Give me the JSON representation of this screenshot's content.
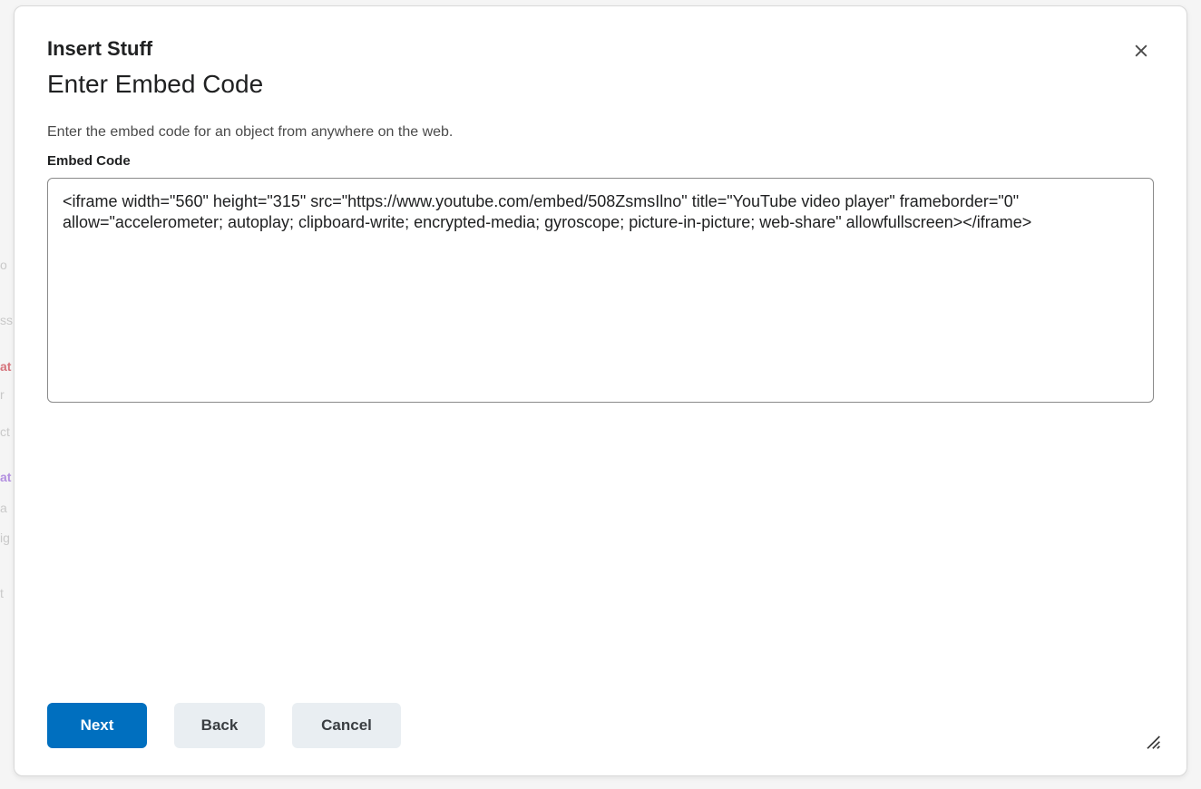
{
  "background": {
    "ghost_lines": [
      "o",
      "ss",
      "at",
      "r",
      "ct",
      "at",
      "a",
      "ig",
      "t"
    ]
  },
  "modal": {
    "title": "Insert Stuff",
    "section_title": "Enter Embed Code",
    "helper_text": "Enter the embed code for an object from anywhere on the web.",
    "field_label": "Embed Code",
    "embed_code_value": "<iframe width=\"560\" height=\"315\" src=\"https://www.youtube.com/embed/508ZsmsIlno\" title=\"YouTube video player\" frameborder=\"0\" allow=\"accelerometer; autoplay; clipboard-write; encrypted-media; gyroscope; picture-in-picture; web-share\" allowfullscreen></iframe>"
  },
  "footer": {
    "next_label": "Next",
    "back_label": "Back",
    "cancel_label": "Cancel"
  }
}
